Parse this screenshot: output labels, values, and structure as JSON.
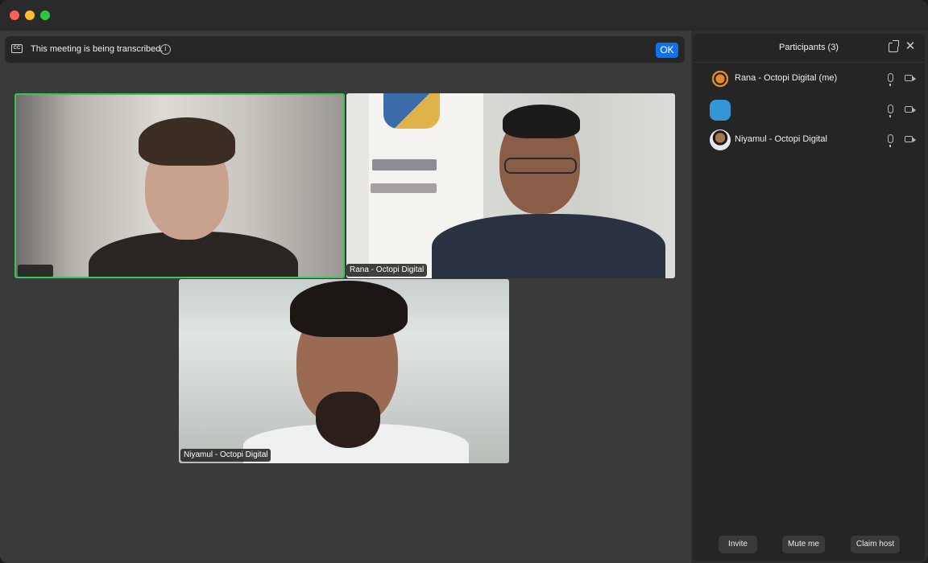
{
  "notice": {
    "text": "This meeting is being transcribed.",
    "ok_label": "OK",
    "cc_label": "CC",
    "info_glyph": "i"
  },
  "videos": [
    {
      "name": ""
    },
    {
      "name": "Rana - Octopi Digital"
    },
    {
      "name": "Niyamul - Octopi Digital"
    }
  ],
  "participants_panel": {
    "title": "Participants (3)",
    "close_glyph": "✕",
    "participants": [
      {
        "name": "Rana - Octopi Digital (me)",
        "avatar": "octopus-logo"
      },
      {
        "name": "",
        "avatar": "blue-square"
      },
      {
        "name": "Niyamul - Octopi Digital",
        "avatar": "photo"
      }
    ],
    "buttons": {
      "invite": "Invite",
      "mute": "Mute me",
      "claim_host": "Claim host"
    }
  },
  "colors": {
    "active_speaker_border": "#34c759",
    "ok_button": "#0e72ed",
    "avatar_blue": "#3596d6"
  }
}
